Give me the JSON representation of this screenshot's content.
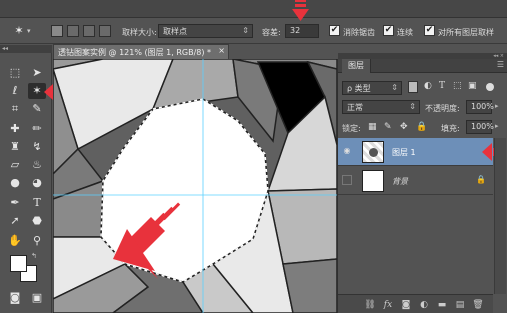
{
  "options_bar": {
    "tool_icon": "magic-wand-icon",
    "sample_size_label": "取样大小:",
    "sample_size_value": "取样点",
    "tolerance_label": "容差:",
    "tolerance_value": "32",
    "antialias_label": "消除锯齿",
    "contiguous_label": "连续",
    "all_layers_label": "对所有图层取样",
    "check_mark": "✔"
  },
  "document": {
    "tab_title": "透钻图案实例 @ 121% (图层 1, RGB/8) *",
    "close_glyph": "×"
  },
  "layers_panel": {
    "tab_label": "图层",
    "filter_kind": "ρ 类型",
    "blend_mode": "正常",
    "opacity_label": "不透明度:",
    "opacity_value": "100%",
    "lock_label": "锁定:",
    "fill_label": "填充:",
    "fill_value": "100%",
    "layers": [
      {
        "name": "图层 1",
        "selected": true,
        "visible": true
      },
      {
        "name": "背景",
        "selected": false,
        "visible": false,
        "locked": true
      }
    ]
  },
  "colors": {
    "annotation_arrow": "#e8323c",
    "selected_layer": "#6d8fb8",
    "ui_panel": "#535353"
  }
}
